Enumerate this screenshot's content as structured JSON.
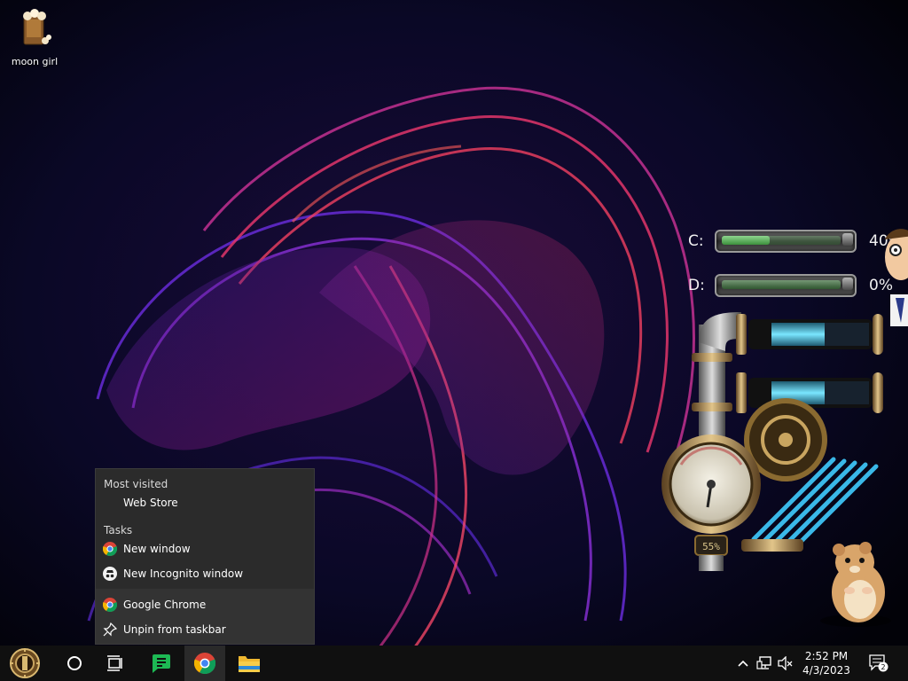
{
  "desktop": {
    "icons": [
      {
        "label": "moon girl",
        "icon": "popcorn-bag-icon"
      }
    ]
  },
  "widgets": {
    "drives": [
      {
        "letter": "C:",
        "percent_text": "40%",
        "used_fraction": 0.4
      },
      {
        "letter": "D:",
        "percent_text": "0%",
        "used_fraction": 0.0
      }
    ],
    "steampunk_gauge": {
      "readout": "55%"
    }
  },
  "jumplist": {
    "most_visited_header": "Most visited",
    "most_visited": [
      {
        "label": "Web Store"
      }
    ],
    "tasks_header": "Tasks",
    "tasks": [
      {
        "label": "New window",
        "icon": "chrome-icon"
      },
      {
        "label": "New Incognito window",
        "icon": "incognito-icon"
      }
    ],
    "app_items": [
      {
        "label": "Google Chrome",
        "icon": "chrome-icon"
      },
      {
        "label": "Unpin from taskbar",
        "icon": "unpin-icon"
      }
    ]
  },
  "taskbar": {
    "buttons": [
      {
        "name": "start-button",
        "icon": "steampunk-start-orb-icon"
      },
      {
        "name": "search-button",
        "icon": "cortana-circle-icon"
      },
      {
        "name": "task-view-button",
        "icon": "task-view-icon"
      },
      {
        "name": "app-green-button",
        "icon": "green-chat-icon"
      },
      {
        "name": "chrome-taskbar-button",
        "icon": "chrome-icon"
      },
      {
        "name": "file-explorer-button",
        "icon": "folder-icon"
      }
    ],
    "tray": {
      "time": "2:52 PM",
      "date": "4/3/2023",
      "notification_count": "2",
      "icons": [
        "chevron-up-icon",
        "network-icon",
        "volume-muted-icon",
        "notification-center-icon"
      ]
    }
  },
  "colors": {
    "taskbar": "#101010",
    "jumplist_bg": "#2b2b2b",
    "gauge_green": "#4caf50",
    "gauge_blue": "#2fb6d8"
  }
}
